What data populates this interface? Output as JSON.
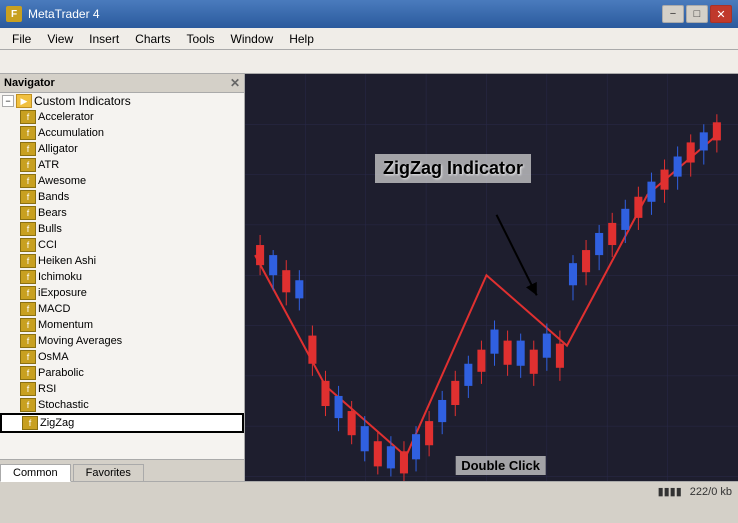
{
  "titleBar": {
    "appIcon": "F",
    "title": "MetaTrader 4",
    "buttons": {
      "minimize": "−",
      "restore": "□",
      "close": "✕"
    }
  },
  "menuBar": {
    "items": [
      "File",
      "View",
      "Insert",
      "Charts",
      "Tools",
      "Window",
      "Help"
    ]
  },
  "innerTitleBar": {
    "title": "Navigator",
    "buttons": {
      "close": "✕"
    }
  },
  "navigator": {
    "header": "Navigator",
    "tree": {
      "root": {
        "label": "Custom Indicators",
        "children": [
          "Accelerator",
          "Accumulation",
          "Alligator",
          "ATR",
          "Awesome",
          "Bands",
          "Bears",
          "Bulls",
          "CCI",
          "Heiken Ashi",
          "Ichimoku",
          "iExposure",
          "MACD",
          "Momentum",
          "Moving Averages",
          "OsMA",
          "Parabolic",
          "RSI",
          "Stochastic",
          "ZigZag"
        ]
      }
    },
    "tabs": [
      "Common",
      "Favorites"
    ]
  },
  "chart": {
    "annotation": "ZigZag Indicator",
    "doubleClick": "Double Click"
  },
  "statusBar": {
    "bars": "222/0 kb"
  }
}
